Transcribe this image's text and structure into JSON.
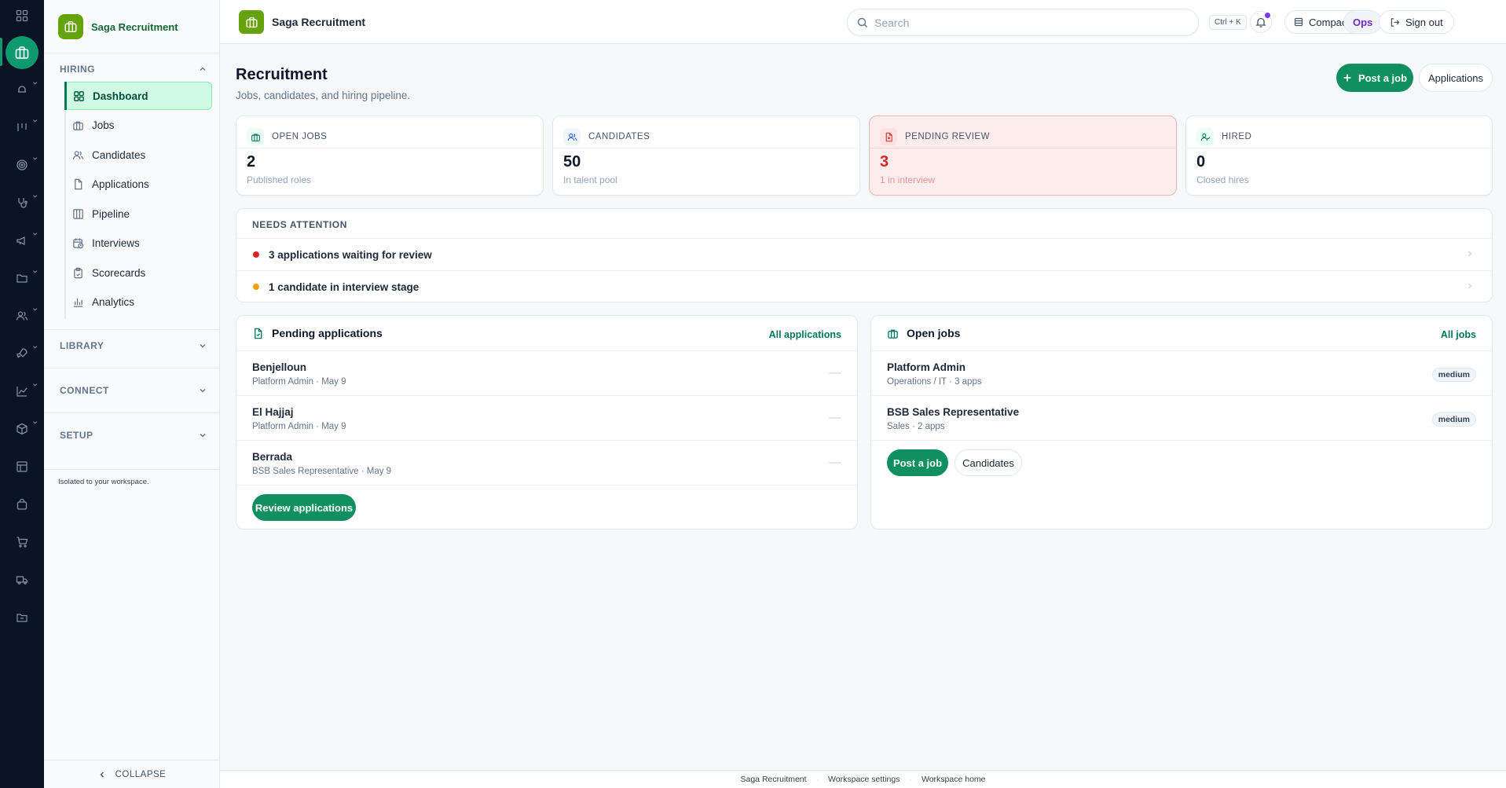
{
  "app": {
    "name": "Saga Recruitment",
    "brand_color": "#65a30d",
    "accent_color": "#0f8f62"
  },
  "rail": {
    "icons": [
      "grid-icon",
      "briefcase-icon",
      "hat-icon",
      "pipeline-icon",
      "target-icon",
      "stethoscope-icon",
      "megaphone-icon",
      "folder-icon",
      "users-icon",
      "rocket-icon",
      "chart-icon",
      "box-icon",
      "table-icon",
      "bag-icon",
      "cart-icon",
      "truck-icon",
      "archive-icon"
    ]
  },
  "sidebar": {
    "sections": {
      "hiring": "HIRING",
      "library": "LIBRARY",
      "connect": "CONNECT",
      "setup": "SETUP"
    },
    "items": [
      {
        "label": "Dashboard",
        "icon": "dashboard-icon",
        "active": true
      },
      {
        "label": "Jobs",
        "icon": "briefcase-icon"
      },
      {
        "label": "Candidates",
        "icon": "users-icon"
      },
      {
        "label": "Applications",
        "icon": "file-icon"
      },
      {
        "label": "Pipeline",
        "icon": "columns-icon"
      },
      {
        "label": "Interviews",
        "icon": "calendar-clock-icon"
      },
      {
        "label": "Scorecards",
        "icon": "clipboard-icon"
      },
      {
        "label": "Analytics",
        "icon": "bar-chart-icon"
      }
    ],
    "isolated_note": "Isolated to your workspace.",
    "collapse_label": "COLLAPSE"
  },
  "topbar": {
    "title": "Saga Recruitment",
    "search_placeholder": "Search",
    "shortcut": "Ctrl + K",
    "view_mode": "Compact",
    "workspace_badge": "Ops",
    "sign_out": "Sign out"
  },
  "main": {
    "title": "Recruitment",
    "subtitle": "Jobs, candidates, and hiring pipeline.",
    "post_job": "Post a job",
    "applications": "Applications",
    "stats": [
      {
        "label": "OPEN JOBS",
        "value": "2",
        "note": "Published roles",
        "icon": "briefcase-icon"
      },
      {
        "label": "CANDIDATES",
        "value": "50",
        "note": "In talent pool",
        "icon": "users-icon"
      },
      {
        "label": "PENDING REVIEW",
        "value": "3",
        "note": "1 in interview",
        "icon": "file-alert-icon",
        "status_color": "#dc2626"
      },
      {
        "label": "HIRED",
        "value": "0",
        "note": "Closed hires",
        "icon": "user-check-icon"
      }
    ],
    "attention": {
      "title": "NEEDS ATTENTION",
      "items": [
        {
          "text": "3 applications waiting for review",
          "color": "#dc2626"
        },
        {
          "text": "1 candidate in interview stage",
          "color": "#f59e0b"
        }
      ]
    },
    "pending": {
      "title": "Pending applications",
      "link": "All applications",
      "rows": [
        {
          "name": "Benjelloun",
          "meta": "Platform Admin · May 9"
        },
        {
          "name": "El Hajjaj",
          "meta": "Platform Admin · May 9"
        },
        {
          "name": "Berrada",
          "meta": "BSB Sales Representative · May 9"
        }
      ],
      "action": "Review applications"
    },
    "open_jobs": {
      "title": "Open jobs",
      "link": "All jobs",
      "rows": [
        {
          "name": "Platform Admin",
          "meta": "Operations / IT · 3 apps",
          "badge": "medium"
        },
        {
          "name": "BSB Sales Representative",
          "meta": "Sales · 2 apps",
          "badge": "medium"
        }
      ],
      "post_job": "Post a job",
      "candidates": "Candidates"
    }
  },
  "footer": {
    "links": [
      "Saga Recruitment",
      "Workspace settings",
      "Workspace home"
    ]
  }
}
